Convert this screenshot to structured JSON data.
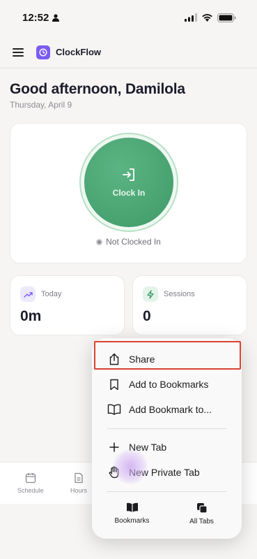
{
  "status_bar": {
    "time": "12:52"
  },
  "header": {
    "app_name": "ClockFlow"
  },
  "greeting": {
    "title": "Good afternoon, Damilola",
    "date": "Thursday, April 9"
  },
  "clock": {
    "button_label": "Clock In",
    "status": "Not Clocked In"
  },
  "stats": [
    {
      "label": "Today",
      "value": "0m"
    },
    {
      "label": "Sessions",
      "value": "0"
    }
  ],
  "bottom_nav": {
    "items": [
      "Schedule",
      "Hours"
    ]
  },
  "context_menu": {
    "items": [
      "Share",
      "Add to Bookmarks",
      "Add Bookmark to...",
      "New Tab",
      "New Private Tab"
    ],
    "bottom": [
      "Bookmarks",
      "All Tabs"
    ]
  },
  "colors": {
    "accent": "#7b5cf0",
    "clock_green": "#4ba574",
    "highlight": "#d9432f"
  }
}
